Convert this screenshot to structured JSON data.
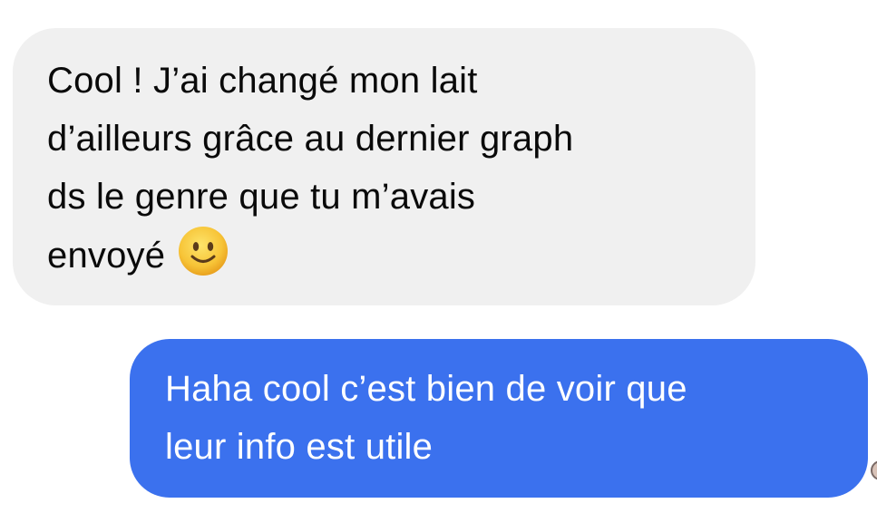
{
  "conversation": {
    "received_message": {
      "lines": [
        "Cool ! J’ai changé mon lait",
        "d’ailleurs grâce au dernier graph",
        "ds le genre que tu m’avais",
        "envoyé"
      ],
      "emoji": "slightly-smiling-face-icon",
      "bubble_color": "#f0f0f0",
      "text_color": "#0a0a0a"
    },
    "sent_message": {
      "lines": [
        "Haha cool c’est bien de voir que",
        "leur info est utile"
      ],
      "bubble_color": "#3b71ee",
      "text_color": "#ffffff"
    }
  }
}
